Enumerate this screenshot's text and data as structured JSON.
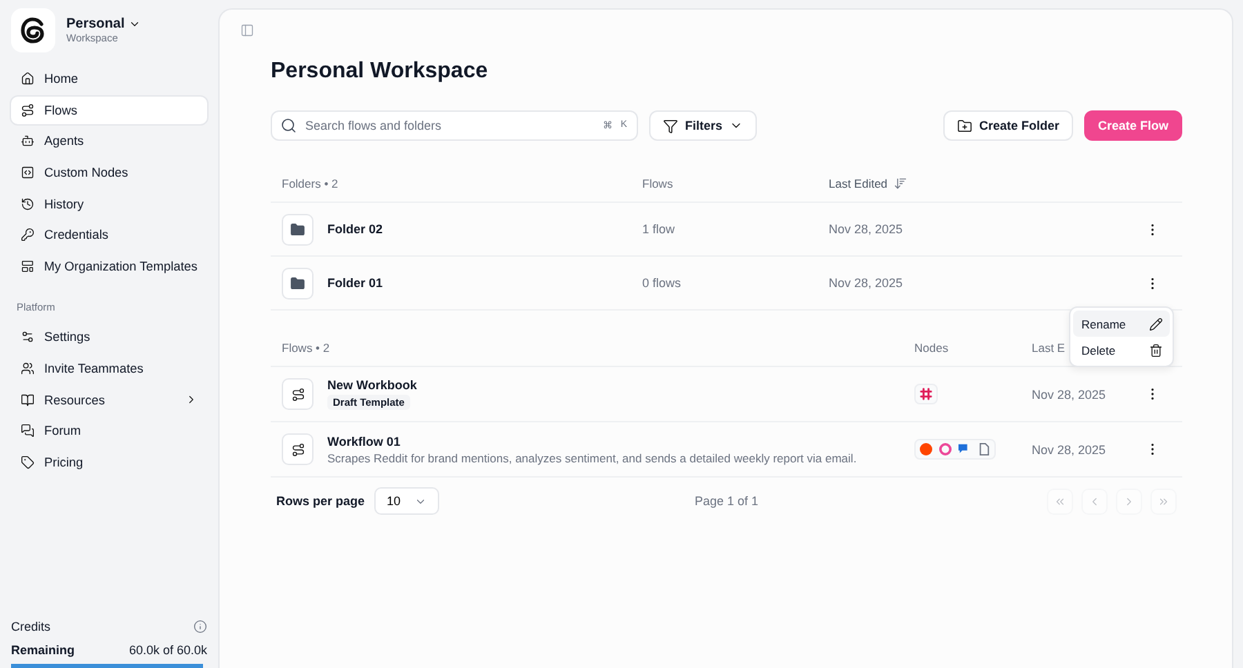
{
  "workspace": {
    "name": "Personal",
    "subtitle": "Workspace"
  },
  "nav": [
    {
      "label": "Home",
      "selected": false
    },
    {
      "label": "Flows",
      "selected": true
    },
    {
      "label": "Agents",
      "selected": false
    },
    {
      "label": "Custom Nodes",
      "selected": false
    },
    {
      "label": "History",
      "selected": false
    },
    {
      "label": "Credentials",
      "selected": false
    },
    {
      "label": "My Organization Templates",
      "selected": false
    }
  ],
  "platform": {
    "heading": "Platform",
    "items": [
      {
        "label": "Settings",
        "expandable": false
      },
      {
        "label": "Invite Teammates",
        "expandable": false
      },
      {
        "label": "Resources",
        "expandable": true
      },
      {
        "label": "Forum",
        "expandable": false
      },
      {
        "label": "Pricing",
        "expandable": false
      }
    ]
  },
  "credits": {
    "label": "Credits",
    "remaining_label": "Remaining",
    "remaining": "60.0k of 60.0k",
    "level": 1
  },
  "page": {
    "title": "Personal Workspace"
  },
  "search": {
    "placeholder": "Search flows and folders",
    "shortcut": [
      "⌘",
      "K"
    ]
  },
  "filters": {
    "label": "Filters"
  },
  "buttons": [
    {
      "label": "Create Folder",
      "kind": "secondary"
    },
    {
      "label": "Create Flow",
      "kind": "primary"
    }
  ],
  "folders": {
    "columns": [
      {
        "label": "Folders • 2",
        "sorted": false
      },
      {
        "label": "Flows",
        "sorted": false
      },
      {
        "label": "Last Edited",
        "sorted": true
      }
    ],
    "rows": [
      {
        "name": "Folder 02",
        "flows": "1 flow",
        "edited": "Nov 28, 2025"
      },
      {
        "name": "Folder 01",
        "flows": "0 flows",
        "edited": "Nov 28, 2025"
      }
    ]
  },
  "context_menu": {
    "items": [
      {
        "label": "Rename",
        "kind": "rename",
        "selected": true
      },
      {
        "label": "Delete",
        "kind": "delete",
        "selected": false
      }
    ]
  },
  "flows": {
    "columns": [
      {
        "label": "Flows • 2"
      },
      {
        "label": "Nodes"
      },
      {
        "label": "Last E"
      }
    ],
    "rows": [
      {
        "name": "New Workbook",
        "tag": "Draft Template",
        "nodes": [
          {
            "kind": "hash",
            "color": "#e01e5a"
          }
        ],
        "edited": "Nov 28, 2025"
      },
      {
        "name": "Workflow 01",
        "description": "Scrapes Reddit for brand mentions, analyzes sentiment, and sends a detailed weekly report via email.",
        "nodes": [
          {
            "kind": "dot",
            "color": "#ff4500"
          },
          {
            "kind": "ring",
            "color": "#ec4899"
          },
          {
            "kind": "chat",
            "color": "#1e6fd9"
          },
          {
            "kind": "doc",
            "color": "#6b7280"
          }
        ],
        "edited": "Nov 28, 2025"
      }
    ]
  },
  "pagination": {
    "rows_label": "Rows per page",
    "rows_value": "10",
    "page": "Page 1 of 1",
    "controls": [
      {
        "kind": "first",
        "disabled": true
      },
      {
        "kind": "prev",
        "disabled": true
      },
      {
        "kind": "next",
        "disabled": true
      },
      {
        "kind": "last",
        "disabled": true
      }
    ]
  }
}
